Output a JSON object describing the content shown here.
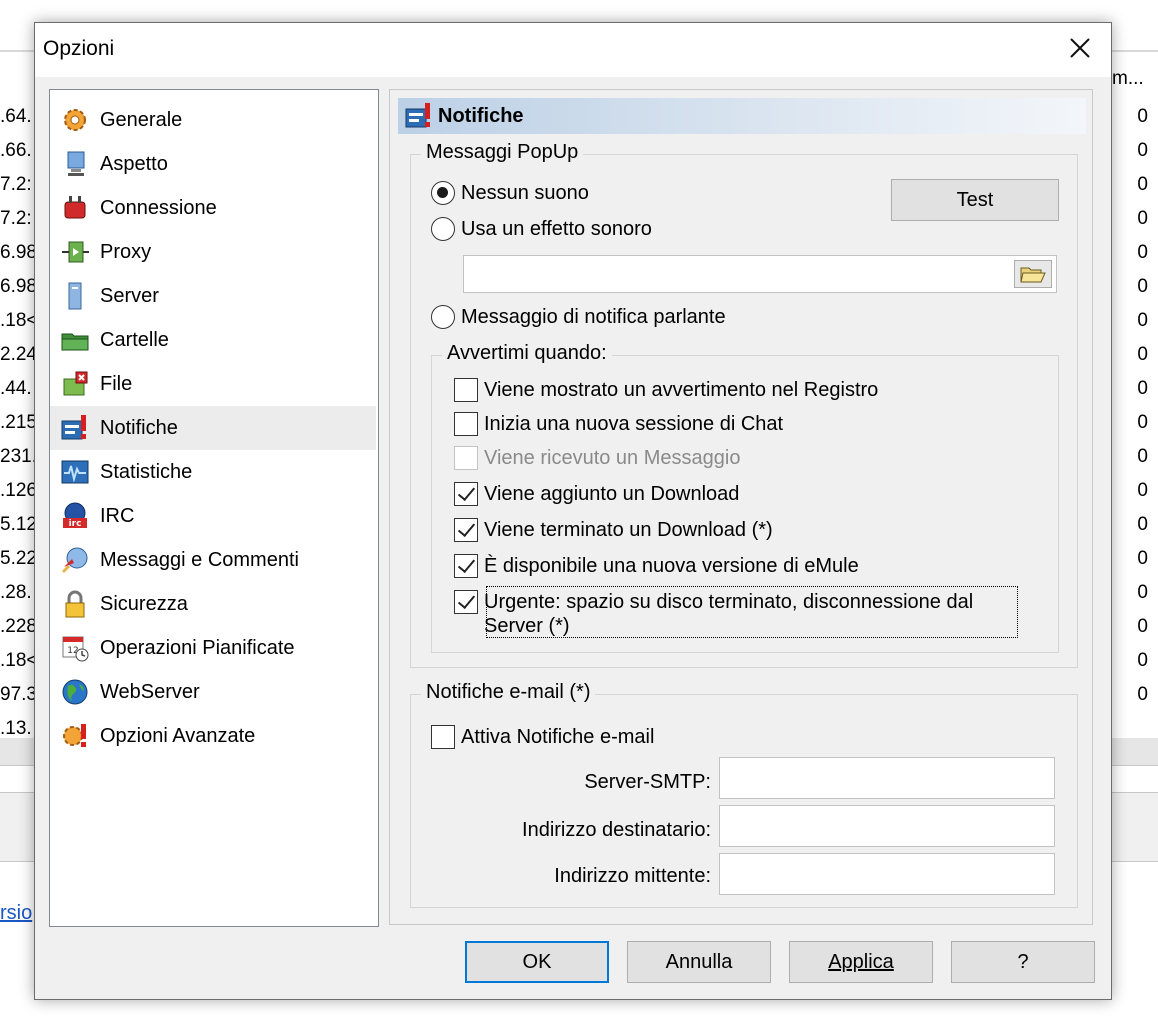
{
  "background": {
    "left_col": [
      ".64.",
      ".66.",
      "7.2:",
      "7.2:",
      "6.98",
      "6.98",
      ".18<",
      "2.24",
      ".44.",
      ".215",
      "231.",
      ".126",
      "5.12",
      "5.22",
      ".28.",
      ".228",
      ".18<",
      "97.3",
      ".13."
    ],
    "right_head": "m...",
    "right_col": [
      "0",
      "0",
      "0",
      "0",
      "0",
      "0",
      "0",
      "0",
      "0",
      "0",
      "0",
      "0",
      "0",
      "0",
      "0",
      "0",
      "0",
      "0"
    ],
    "link_fragment": "rsio"
  },
  "dialog": {
    "title": "Opzioni",
    "nav": [
      {
        "label": "Generale",
        "icon": "gear-icon"
      },
      {
        "label": "Aspetto",
        "icon": "monitor-icon"
      },
      {
        "label": "Connessione",
        "icon": "plug-icon"
      },
      {
        "label": "Proxy",
        "icon": "proxy-icon"
      },
      {
        "label": "Server",
        "icon": "server-icon"
      },
      {
        "label": "Cartelle",
        "icon": "folder-icon"
      },
      {
        "label": "File",
        "icon": "file-icon"
      },
      {
        "label": "Notifiche",
        "icon": "notification-icon"
      },
      {
        "label": "Statistiche",
        "icon": "statistics-icon"
      },
      {
        "label": "IRC",
        "icon": "irc-icon"
      },
      {
        "label": "Messaggi e Commenti",
        "icon": "messages-icon"
      },
      {
        "label": "Sicurezza",
        "icon": "lock-icon"
      },
      {
        "label": "Operazioni Pianificate",
        "icon": "calendar-icon"
      },
      {
        "label": "WebServer",
        "icon": "globe-icon"
      },
      {
        "label": "Opzioni Avanzate",
        "icon": "advanced-gear-icon"
      }
    ],
    "selected_nav": "Notifiche",
    "page": {
      "header": "Notifiche",
      "popup_group": {
        "legend": "Messaggi PopUp",
        "radio_none": "Nessun suono",
        "radio_sound": "Usa un effetto sonoro",
        "radio_speech": "Messaggio di notifica parlante",
        "selected": "Nessun suono",
        "test_button": "Test",
        "sound_path": ""
      },
      "warn_group": {
        "legend": "Avvertimi quando:",
        "items": [
          {
            "label": "Viene mostrato un avvertimento nel Registro",
            "checked": false,
            "disabled": false
          },
          {
            "label": "Inizia una nuova sessione di Chat",
            "checked": false,
            "disabled": false
          },
          {
            "label": "Viene ricevuto un Messaggio",
            "checked": false,
            "disabled": true
          },
          {
            "label": "Viene aggiunto un Download",
            "checked": true,
            "disabled": false
          },
          {
            "label": "Viene terminato un Download (*)",
            "checked": true,
            "disabled": false
          },
          {
            "label": "È disponibile una nuova versione di eMule",
            "checked": true,
            "disabled": false
          },
          {
            "label": "Urgente: spazio su disco terminato, disconnessione dal Server (*)",
            "checked": true,
            "disabled": false
          }
        ]
      },
      "email_group": {
        "legend": "Notifiche e-mail (*)",
        "enable_label": "Attiva Notifiche e-mail",
        "enabled": false,
        "smtp_label": "Server-SMTP:",
        "smtp_value": "",
        "recipient_label": "Indirizzo destinatario:",
        "recipient_value": "",
        "sender_label": "Indirizzo mittente:",
        "sender_value": ""
      }
    },
    "buttons": {
      "ok": "OK",
      "cancel": "Annulla",
      "apply": "Applica",
      "help": "?"
    }
  }
}
